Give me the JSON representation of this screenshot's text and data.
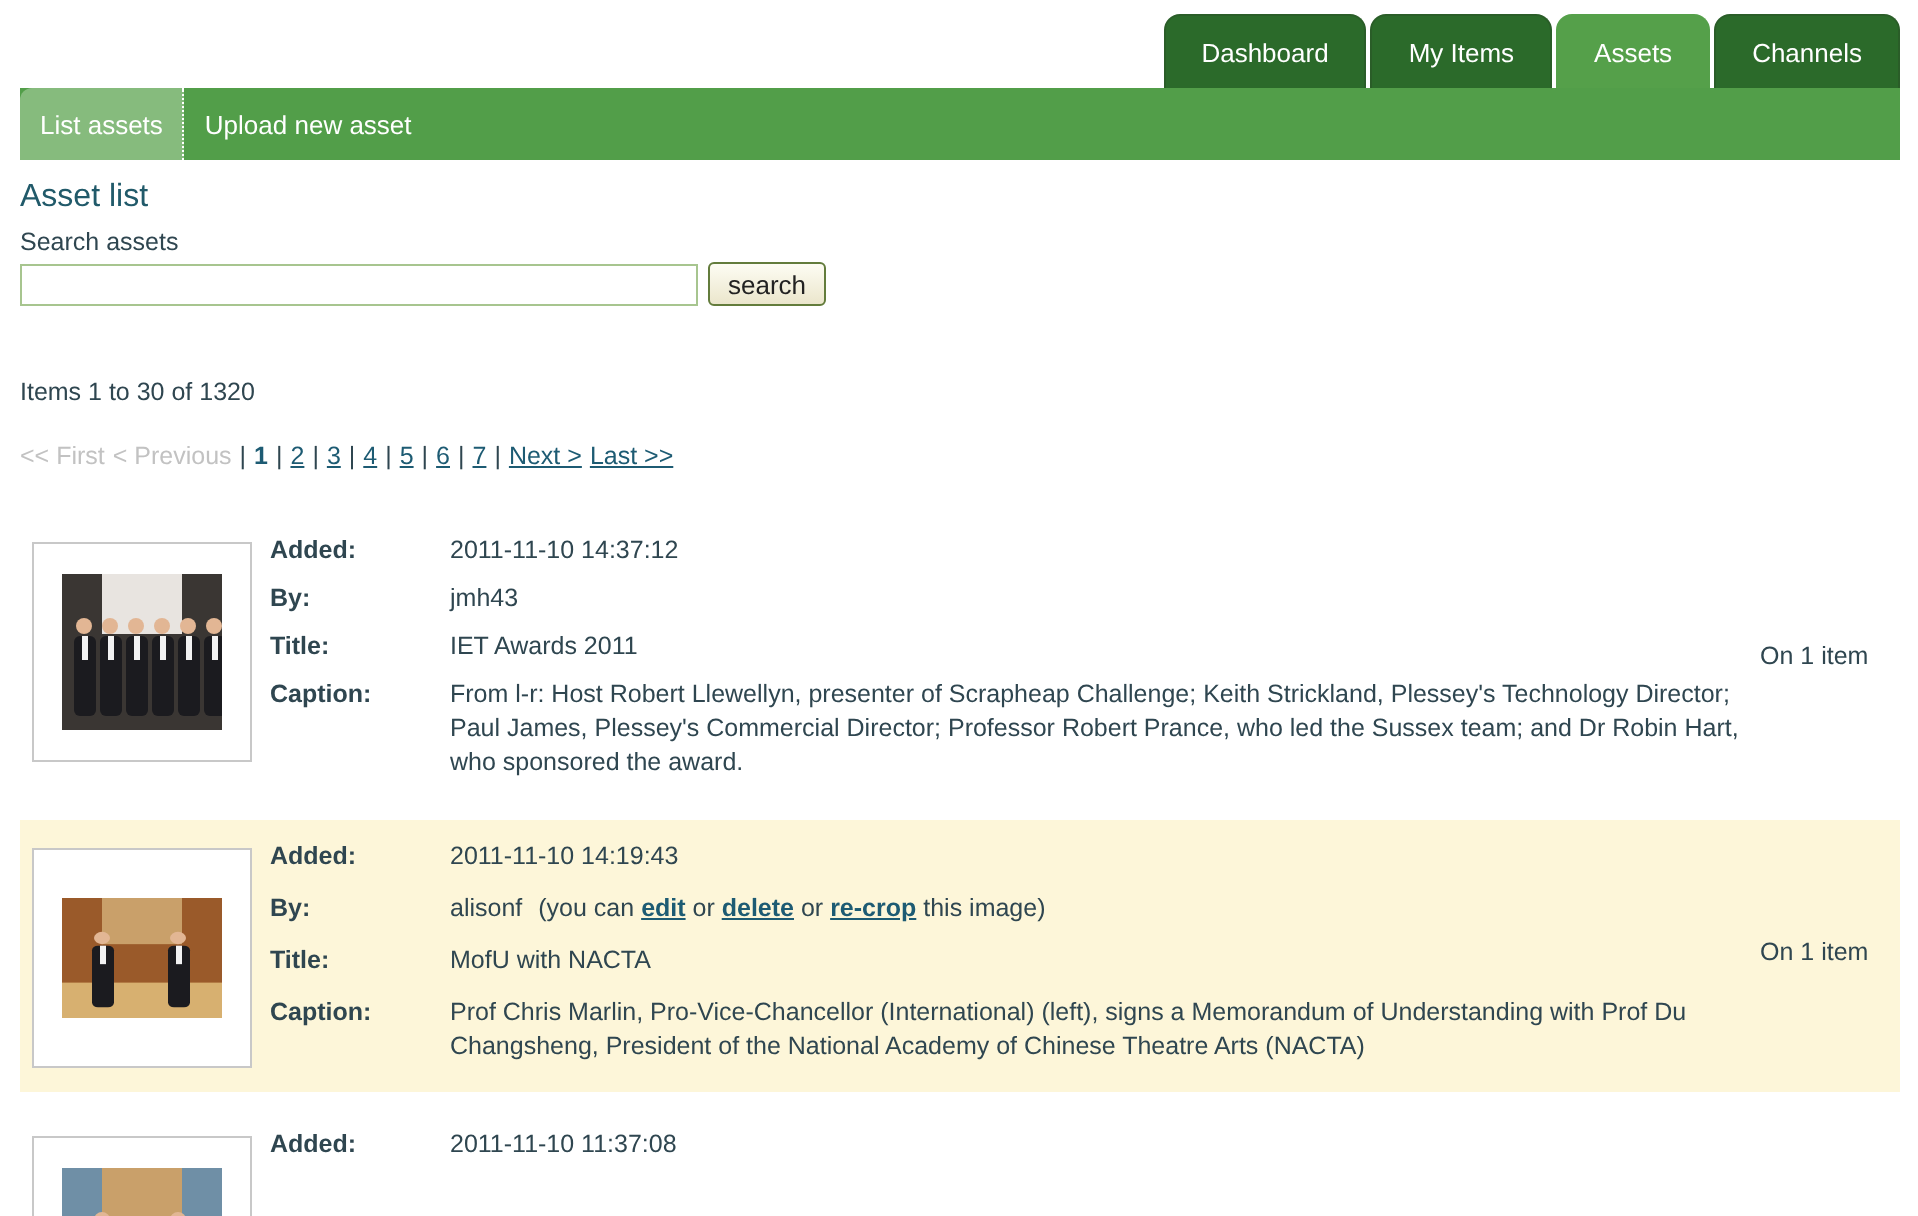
{
  "tabs": [
    {
      "label": "Dashboard",
      "selected": false
    },
    {
      "label": "My Items",
      "selected": false
    },
    {
      "label": "Assets",
      "selected": true
    },
    {
      "label": "Channels",
      "selected": false
    }
  ],
  "subnav": [
    {
      "label": "List assets",
      "selected": true
    },
    {
      "label": "Upload new asset",
      "selected": false
    }
  ],
  "heading": "Asset list",
  "search": {
    "label": "Search assets",
    "button": "search"
  },
  "summary": "Items 1 to 30 of 1320",
  "pagination": {
    "separator": "|",
    "first": {
      "label": "<< First",
      "disabled": true
    },
    "previous": {
      "label": "< Previous",
      "disabled": true
    },
    "pages": [
      {
        "label": "1",
        "selected": true
      },
      {
        "label": "2",
        "selected": false
      },
      {
        "label": "3",
        "selected": false
      },
      {
        "label": "4",
        "selected": false
      },
      {
        "label": "5",
        "selected": false
      },
      {
        "label": "6",
        "selected": false
      },
      {
        "label": "7",
        "selected": false
      }
    ],
    "next": {
      "label": "Next >",
      "disabled": false
    },
    "last": {
      "label": "Last >>",
      "disabled": false
    }
  },
  "assets": [
    {
      "highlighted": false,
      "thumbnail": {
        "kind": "picture"
      },
      "fields": [
        {
          "label": "Added:",
          "value": "2011-11-10 14:37:12"
        },
        {
          "label": "By:",
          "value": "jmh43"
        },
        {
          "label": "Title:",
          "value": "IET Awards 2011"
        },
        {
          "label": "Caption:",
          "value": "From l-r: Host Robert Llewellyn, presenter of Scrapheap Challenge; Keith Strickland, Plessey's Technology Director; Paul James, Plessey's Commercial Director; Professor Robert Prance, who led the Sussex team; and Dr Robin Hart, who sponsored the award."
        }
      ],
      "usage": "On 1 item"
    },
    {
      "highlighted": true,
      "thumbnail": {
        "kind": "picture"
      },
      "fields": [
        {
          "label": "Added:",
          "value": "2011-11-10 14:19:43"
        },
        {
          "label": "By:",
          "value": "alisonf",
          "note": [
            {
              "kind": "text",
              "text": "(you can "
            },
            {
              "kind": "link",
              "text": "edit"
            },
            {
              "kind": "text",
              "text": " or "
            },
            {
              "kind": "link",
              "text": "delete"
            },
            {
              "kind": "text",
              "text": " or "
            },
            {
              "kind": "link",
              "text": "re-crop"
            },
            {
              "kind": "text",
              "text": " this image)"
            }
          ]
        },
        {
          "label": "Title:",
          "value": "MofU with NACTA"
        },
        {
          "label": "Caption:",
          "value": "Prof Chris Marlin, Pro-Vice-Chancellor (International) (left), signs a Memorandum of Understanding with Prof Du Changsheng, President of the National Academy of Chinese Theatre Arts (NACTA)"
        }
      ],
      "usage": "On 1 item"
    },
    {
      "highlighted": false,
      "thumbnail": {
        "kind": "picture"
      },
      "fields": [
        {
          "label": "Added:",
          "value": "2011-11-10 11:37:08"
        }
      ]
    }
  ]
}
